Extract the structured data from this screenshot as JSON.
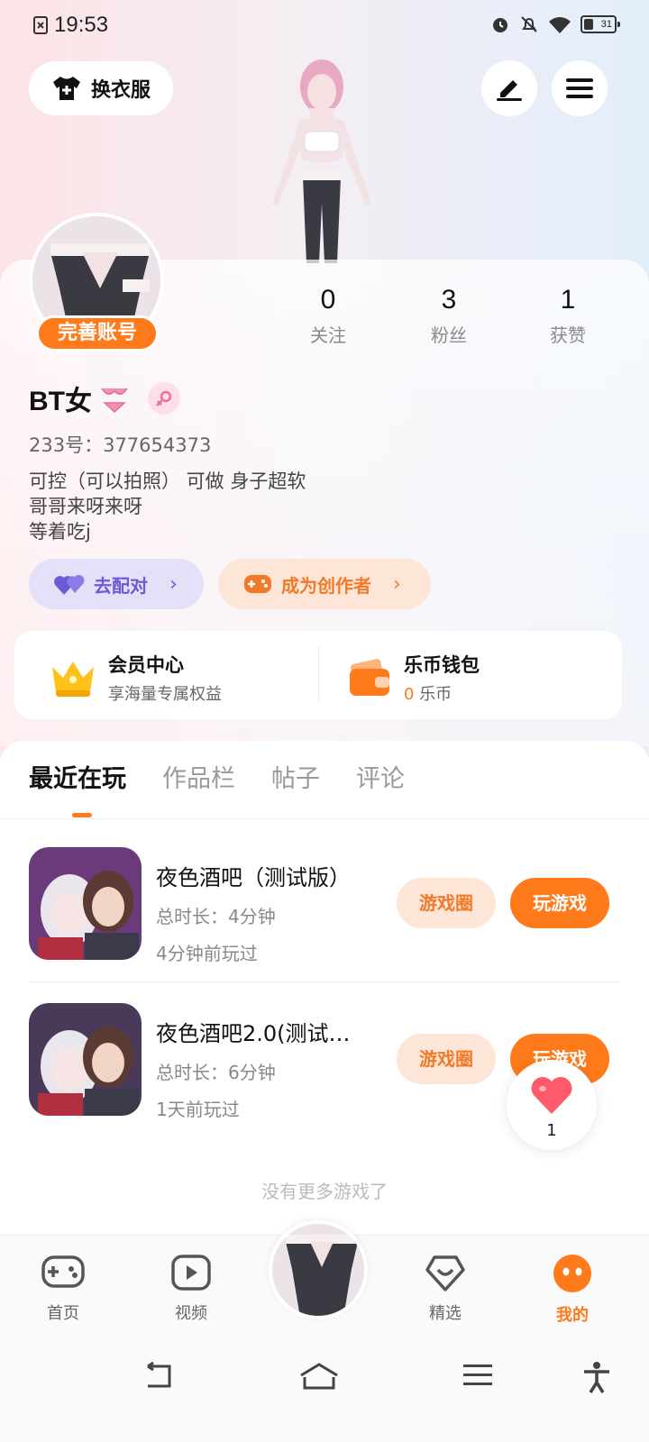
{
  "status_bar": {
    "time": "19:53",
    "battery": "31"
  },
  "top_actions": {
    "outfit_label": "换衣服"
  },
  "profile": {
    "complete_account_label": "完善账号",
    "username": "BT女",
    "account_id": "233号：377654373",
    "bio_lines": [
      "可控（可以拍照） 可做 身子超软",
      "哥哥来呀来呀",
      "等着吃j"
    ],
    "stats": [
      {
        "value": "0",
        "label": "关注"
      },
      {
        "value": "3",
        "label": "粉丝"
      },
      {
        "value": "1",
        "label": "获赞"
      }
    ],
    "match_label": "去配对",
    "creator_label": "成为创作者"
  },
  "member": {
    "center_title": "会员中心",
    "center_sub": "享海量专属权益",
    "wallet_title": "乐币钱包",
    "wallet_amount": "0",
    "wallet_unit": "乐币"
  },
  "tabs": [
    "最近在玩",
    "作品栏",
    "帖子",
    "评论"
  ],
  "games": [
    {
      "title": "夜色酒吧（测试版）",
      "duration": "总时长：4分钟",
      "last_played": "4分钟前玩过",
      "circle_label": "游戏圈",
      "play_label": "玩游戏"
    },
    {
      "title": "夜色酒吧2.0(测试…",
      "duration": "总时长：6分钟",
      "last_played": "1天前玩过",
      "circle_label": "游戏圈",
      "play_label": "玩游戏"
    }
  ],
  "no_more_text": "没有更多游戏了",
  "like_float": {
    "count": "1"
  },
  "bottom_nav": [
    {
      "label": "首页",
      "icon": "gamepad-icon"
    },
    {
      "label": "视频",
      "icon": "video-icon"
    },
    {
      "label": "精选",
      "icon": "heart-chat-icon"
    },
    {
      "label": "我的",
      "icon": "face-icon"
    }
  ],
  "colors": {
    "accent": "#ff7a1a",
    "match_purple": "#6b5bd6",
    "text_dark": "#111111"
  }
}
